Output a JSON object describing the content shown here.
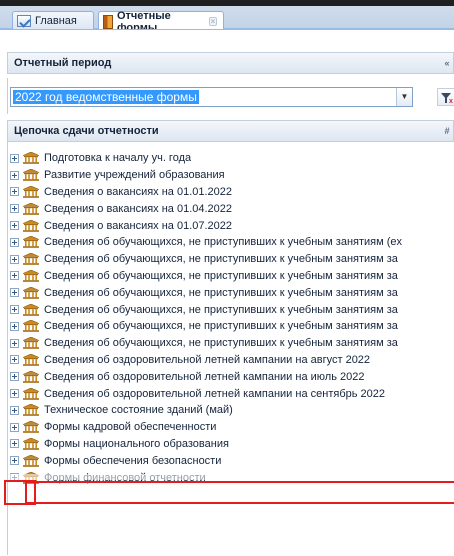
{
  "tabs": [
    {
      "label": "Главная",
      "icon": "home-icon",
      "active": false
    },
    {
      "label": "Отчетные формы",
      "icon": "forms-icon",
      "active": true
    }
  ],
  "period_panel": {
    "title": "Отчетный период",
    "collapse_glyph": "«",
    "selected_value": "2022 год ведомственные формы"
  },
  "chain_panel": {
    "title": "Цепочка сдачи отчетности",
    "tool_glyph": "#",
    "items": [
      {
        "label": "Подготовка к началу уч. года"
      },
      {
        "label": "Развитие учреждений образования"
      },
      {
        "label": "Сведения о вакансиях на 01.01.2022"
      },
      {
        "label": "Сведения о вакансиях на 01.04.2022"
      },
      {
        "label": "Сведения о вакансиях на 01.07.2022"
      },
      {
        "label": "Сведения об обучающихся, не приступивших к учебным занятиям (ex"
      },
      {
        "label": "Сведения об обучающихся, не приступивших к учебным занятиям за"
      },
      {
        "label": "Сведения об обучающихся, не приступивших к учебным занятиям за"
      },
      {
        "label": "Сведения об обучающихся, не приступивших к учебным занятиям за"
      },
      {
        "label": "Сведения об обучающихся, не приступивших к учебным занятиям за"
      },
      {
        "label": "Сведения об обучающихся, не приступивших к учебным занятиям за"
      },
      {
        "label": "Сведения об обучающихся, не приступивших к учебным занятиям за"
      },
      {
        "label": "Сведения об оздоровительной летней кампании на август 2022"
      },
      {
        "label": "Сведения об оздоровительной летней кампании на июль 2022"
      },
      {
        "label": "Сведения об оздоровительной летней кампании на сентябрь 2022"
      },
      {
        "label": "Техническое состояние зданий (май)"
      },
      {
        "label": "Формы кадровой обеспеченности"
      },
      {
        "label": "Формы национального образования"
      },
      {
        "label": "Формы обеспечения безопасности"
      },
      {
        "label": "Формы финансовой отчетности"
      }
    ]
  },
  "colors": {
    "highlight": "#e31d1d",
    "selection": "#3399ff",
    "header_border": "#99bbe8"
  }
}
